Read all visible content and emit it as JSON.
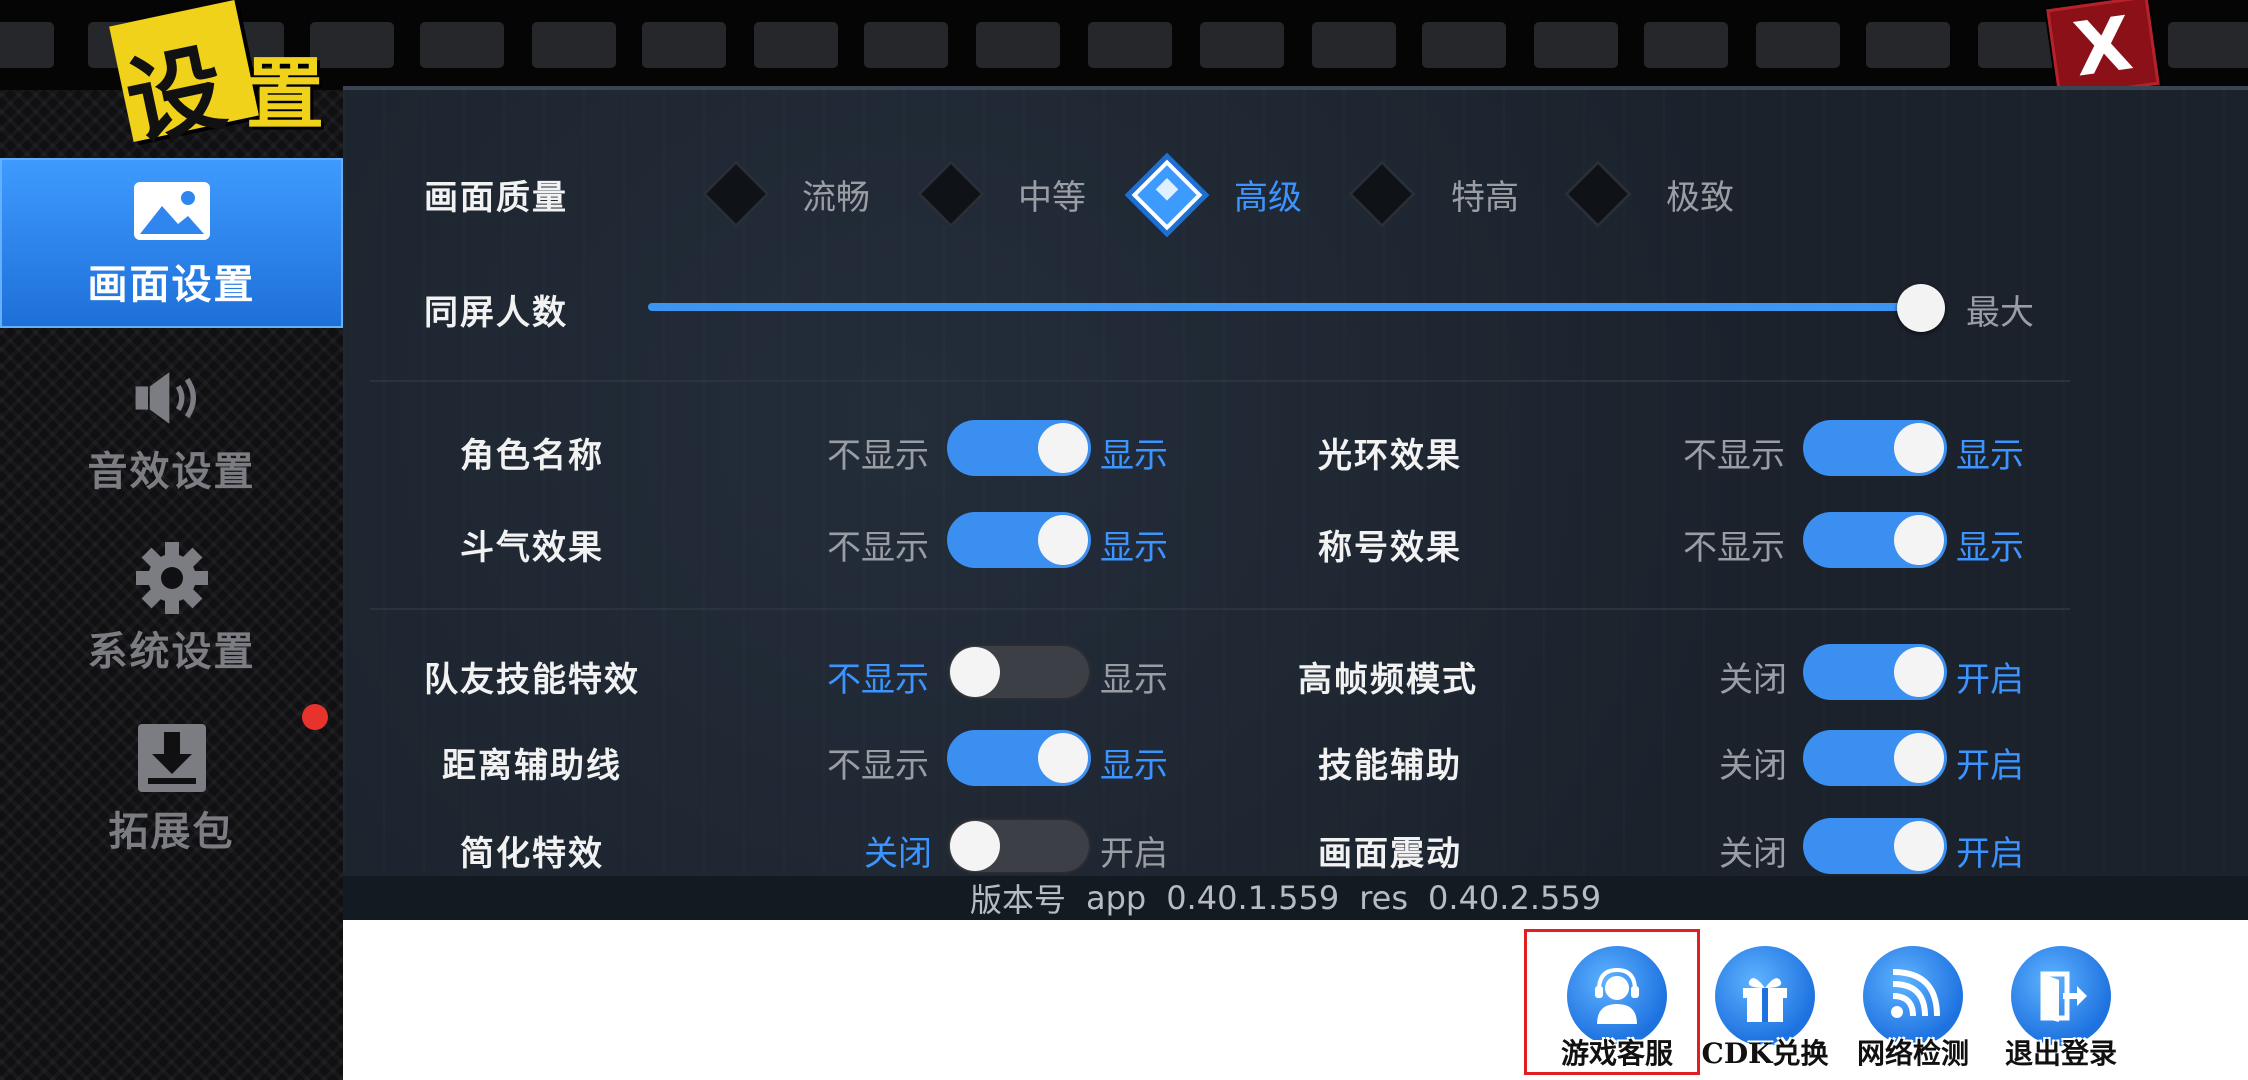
{
  "title": "设置",
  "close_label": "X",
  "sidebar": {
    "items": [
      {
        "label": "画面设置",
        "icon": "image-icon",
        "active": true
      },
      {
        "label": "音效设置",
        "icon": "speaker-icon",
        "active": false
      },
      {
        "label": "系统设置",
        "icon": "gear-icon",
        "active": false
      },
      {
        "label": "拓展包",
        "icon": "download-icon",
        "active": false
      }
    ]
  },
  "quality": {
    "label": "画面质量",
    "options": [
      "流畅",
      "中等",
      "高级",
      "特高",
      "极致"
    ],
    "selected": "高级"
  },
  "players": {
    "label": "同屏人数",
    "value_label": "最大",
    "level": 1.0
  },
  "toggles": [
    {
      "label": "角色名称",
      "off": "不显示",
      "on": "显示",
      "state": true
    },
    {
      "label": "光环效果",
      "off": "不显示",
      "on": "显示",
      "state": true
    },
    {
      "label": "斗气效果",
      "off": "不显示",
      "on": "显示",
      "state": true
    },
    {
      "label": "称号效果",
      "off": "不显示",
      "on": "显示",
      "state": true
    },
    {
      "label": "队友技能特效",
      "off": "不显示",
      "on": "显示",
      "state": false
    },
    {
      "label": "高帧频模式",
      "off": "关闭",
      "on": "开启",
      "state": true
    },
    {
      "label": "距离辅助线",
      "off": "不显示",
      "on": "显示",
      "state": true
    },
    {
      "label": "技能辅助",
      "off": "关闭",
      "on": "开启",
      "state": true
    },
    {
      "label": "简化特效",
      "off": "关闭",
      "on": "开启",
      "state": false
    },
    {
      "label": "画面震动",
      "off": "关闭",
      "on": "开启",
      "state": true
    }
  ],
  "version": {
    "label": "版本号",
    "app_label": "app",
    "app_version": "0.40.1.559",
    "res_label": "res",
    "res_version": "0.40.2.559"
  },
  "bottom_buttons": [
    {
      "label": "游戏客服",
      "icon": "customer-service-icon"
    },
    {
      "label": "CDK兑换",
      "icon": "gift-icon"
    },
    {
      "label": "网络检测",
      "icon": "wifi-icon"
    },
    {
      "label": "退出登录",
      "icon": "logout-icon"
    }
  ],
  "colors": {
    "accent": "#3b94ff",
    "active_tab": "#2b84f0",
    "close": "#8c1018",
    "logo": "#f0d21a"
  }
}
